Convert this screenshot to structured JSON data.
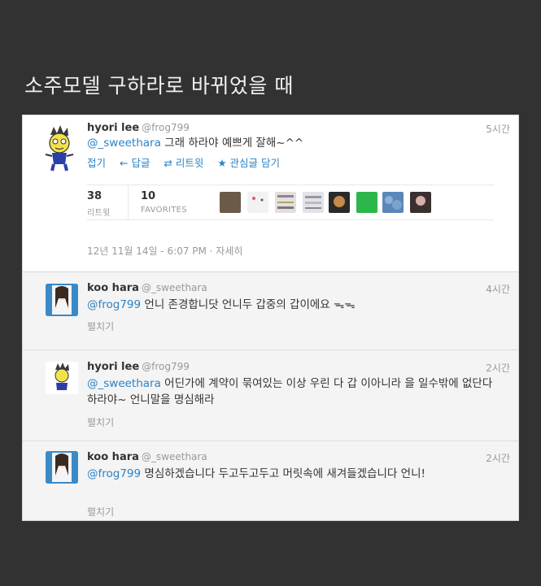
{
  "page_title": "소주모델 구하라로 바뀌었을 때",
  "main_tweet": {
    "name": "hyori lee",
    "handle": "@frog799",
    "time": "5시간",
    "mention": "@_sweethara",
    "text": " 그래 하라야 예쁘게 잘해~^^",
    "actions": {
      "collapse": "접기",
      "reply": "← 답글",
      "retweet": "⇄ 리트윗",
      "favorite": "★ 관심글 담기"
    },
    "stats": {
      "retweets_count": "38",
      "retweets_label": "리트윗",
      "favorites_count": "10",
      "favorites_label": "FAVORITES"
    },
    "meta": "12년 11월 14일 - 6:07 PM · 자세히"
  },
  "replies": [
    {
      "name": "koo hara",
      "handle": "@_sweethara",
      "time": "4시간",
      "mention": "@frog799",
      "text": " 언니 존경합니닷 언니두 갑중의 갑이에요 ᯓᯓ",
      "expand": "펼치기"
    },
    {
      "name": "hyori lee",
      "handle": "@frog799",
      "time": "2시간",
      "mention": "@_sweethara",
      "text": " 어딘가에 계약이 묶여있는 이상 우린 다 갑 이아니라 을 일수밖에 없단다 하라야~ 언니말을 명심해라",
      "expand": "펼치기"
    },
    {
      "name": "koo hara",
      "handle": "@_sweethara",
      "time": "2시간",
      "mention": "@frog799",
      "text": " 명심하겠습니다 두고두고두고 머릿속에 새겨들겠습니다 언니!",
      "expand": "펼치기"
    }
  ],
  "favoriter_colors": [
    "#6b5a48",
    "#f2f2f2",
    "#e6dede",
    "#e2e2ea",
    "#2a2a2a",
    "#2cb74a",
    "#5b86b8",
    "#3a3030"
  ]
}
